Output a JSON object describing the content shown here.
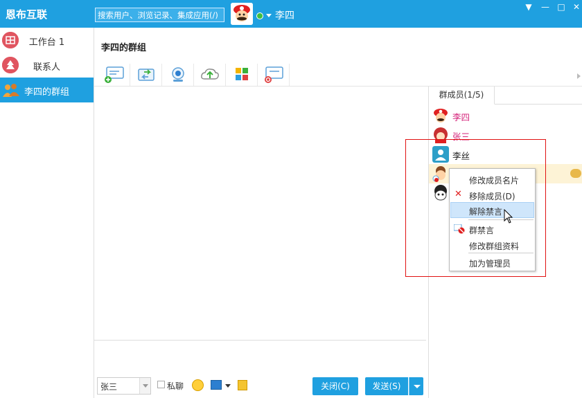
{
  "app": {
    "title": "恩布互联"
  },
  "search": {
    "placeholder": "搜索用户、浏览记录、集成应用(/)"
  },
  "user": {
    "name": "李四"
  },
  "window": {
    "menu_icon": "▼",
    "minimize_icon": "—",
    "maximize_icon": "□",
    "close_icon": "✕"
  },
  "sidebar": {
    "items": [
      {
        "label": "工作台  1",
        "icon": "grid-icon"
      },
      {
        "label": "联系人",
        "icon": "tree-icon"
      },
      {
        "label": "李四的群组",
        "icon": "group-icon",
        "active": true
      }
    ]
  },
  "chat": {
    "title": "李四的群组",
    "toolbar": [
      "add-member-icon",
      "transfer-file-icon",
      "video-icon",
      "upload-icon",
      "apps-icon",
      "quit-group-icon"
    ]
  },
  "bottom": {
    "sender": "张三",
    "private_label": "私聊",
    "close_label": "关闭(C)",
    "send_label": "发送(S)"
  },
  "members": {
    "tab_label": "群成员(1/5)",
    "list": [
      {
        "name": "李四",
        "color": "#d4237a"
      },
      {
        "name": "张三",
        "color": "#d4237a"
      },
      {
        "name": "李丝",
        "color": "#222222"
      },
      {
        "name": "",
        "color": "#222222"
      },
      {
        "name": "",
        "color": "#222222"
      }
    ]
  },
  "context_menu": {
    "items": [
      {
        "label": "修改成员名片"
      },
      {
        "label": "移除成员(D)"
      },
      {
        "label": "解除禁言"
      },
      {
        "label": "群禁言"
      },
      {
        "label": "修改群组资料"
      },
      {
        "label": "加为管理员"
      }
    ]
  },
  "colors": {
    "accent": "#1fa0e0",
    "highlight_box": "#e01010",
    "member_name_pink": "#d4237a"
  }
}
